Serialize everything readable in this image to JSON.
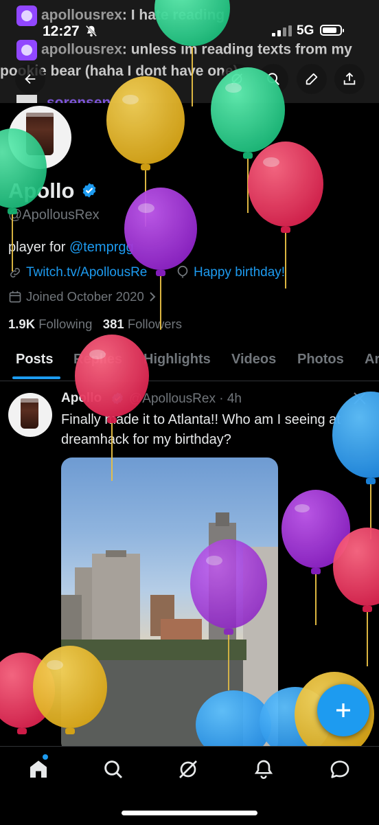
{
  "status_bar": {
    "time": "12:27",
    "network": "5G"
  },
  "banner": {
    "chat_lines": [
      {
        "user": "apollousrex",
        "text": ": I hate reading"
      },
      {
        "user": "apollousrex",
        "text": ": unless im reading texts from my"
      }
    ],
    "chat_line_cont": "pookie bear (haha I dont have one)",
    "chat_line_partial": "sorensen"
  },
  "profile": {
    "name": "Apollo",
    "handle": "@ApollousRex",
    "bio_prefix": "player for ",
    "bio_link": "@temprgg",
    "website": "Twitch.tv/ApollousRe",
    "birthday": "Happy birthday!",
    "joined": "Joined October 2020",
    "following_count": "1.9K",
    "following_label": "Following",
    "followers_count": "381",
    "followers_label": "Followers"
  },
  "tabs": [
    "Posts",
    "Replies",
    "Highlights",
    "Videos",
    "Photos",
    "Ar"
  ],
  "post": {
    "name": "Apollo",
    "handle": "@ApollousRex · 4h",
    "text": "Finally made it to Atlanta!! Who am I seeing at dreamhack for my birthday?"
  },
  "icons": {
    "back": "back-arrow-icon",
    "grok": "grok-icon",
    "search": "search-icon",
    "edit": "pencil-icon",
    "share": "share-icon",
    "fab": "plus-icon",
    "nav": [
      "home-icon",
      "search-icon",
      "grok-icon",
      "bell-icon",
      "messages-icon"
    ]
  },
  "colors": {
    "accent": "#1d9bf0",
    "background": "#000000",
    "text": "#e7e9ea",
    "muted": "#71767b"
  }
}
